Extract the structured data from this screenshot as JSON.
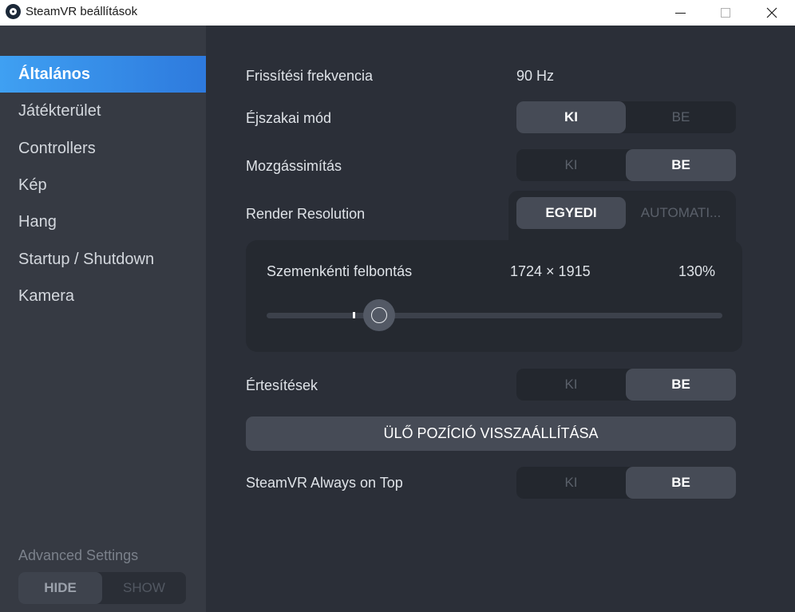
{
  "window": {
    "title": "SteamVR beállítások"
  },
  "sidebar": {
    "items": [
      {
        "label": "Általános",
        "active": true
      },
      {
        "label": "Játékterület",
        "active": false
      },
      {
        "label": "Controllers",
        "active": false
      },
      {
        "label": "Kép",
        "active": false
      },
      {
        "label": "Hang",
        "active": false
      },
      {
        "label": "Startup / Shutdown",
        "active": false
      },
      {
        "label": "Kamera",
        "active": false
      }
    ],
    "advanced": {
      "label": "Advanced Settings",
      "hide_label": "HIDE",
      "show_label": "SHOW",
      "selected": "HIDE"
    }
  },
  "settings": {
    "refresh_rate": {
      "label": "Frissítési frekvencia",
      "value": "90 Hz"
    },
    "night_mode": {
      "label": "Éjszakai mód",
      "off_label": "KI",
      "on_label": "BE",
      "selected": "KI"
    },
    "motion_smoothing": {
      "label": "Mozgássimítás",
      "off_label": "KI",
      "on_label": "BE",
      "selected": "BE"
    },
    "render_resolution": {
      "label": "Render Resolution",
      "custom_label": "EGYEDI",
      "auto_label": "AUTOMATI...",
      "selected": "EGYEDI",
      "per_eye_label": "Szemenkénti felbontás",
      "dimensions": "1724 × 1915",
      "percent": "130%",
      "slider_fraction": 0.247
    },
    "notifications": {
      "label": "Értesítések",
      "off_label": "KI",
      "on_label": "BE",
      "selected": "BE"
    },
    "reset_seated": {
      "label": "ÜLŐ POZÍCIÓ VISSZAÁLLÍTÁSA"
    },
    "always_on_top": {
      "label": "SteamVR Always on Top",
      "off_label": "KI",
      "on_label": "BE",
      "selected": "BE"
    }
  },
  "colors": {
    "accent_start": "#3fa0f2",
    "accent_end": "#2d79dd",
    "sidebar_bg": "#363a43",
    "main_bg": "#2b2f38"
  }
}
